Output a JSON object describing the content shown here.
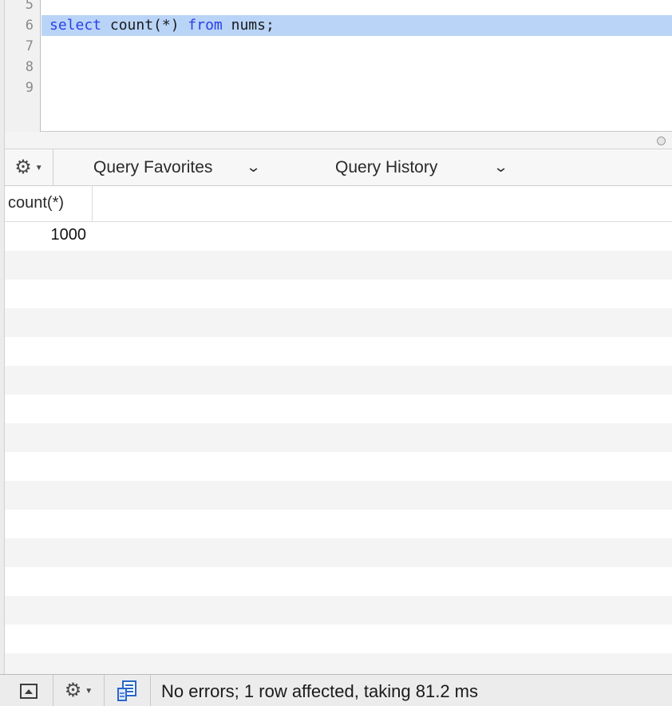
{
  "editor": {
    "lines": [
      {
        "no": "5",
        "tokens": []
      },
      {
        "no": "6",
        "selected": true,
        "tokens": [
          {
            "text": "select",
            "kind": "kw"
          },
          {
            "text": " count(*) ",
            "kind": "txt"
          },
          {
            "text": "from",
            "kind": "kw"
          },
          {
            "text": " nums;",
            "kind": "txt"
          }
        ]
      },
      {
        "no": "7",
        "tokens": []
      },
      {
        "no": "8",
        "tokens": []
      },
      {
        "no": "9",
        "tokens": []
      }
    ]
  },
  "toolbar": {
    "gear_icon": "gear-icon",
    "query_favorites_label": "Query Favorites",
    "query_history_label": "Query History"
  },
  "results": {
    "columns": [
      "count(*)"
    ],
    "rows": [
      [
        "1000"
      ]
    ],
    "empty_rows": 15
  },
  "status": {
    "message": "No errors; 1 row affected, taking 81.2 ms"
  },
  "colors": {
    "keyword": "#2a3fe8",
    "selection": "#b9d4f7",
    "alt_row": "#f4f4f4"
  }
}
